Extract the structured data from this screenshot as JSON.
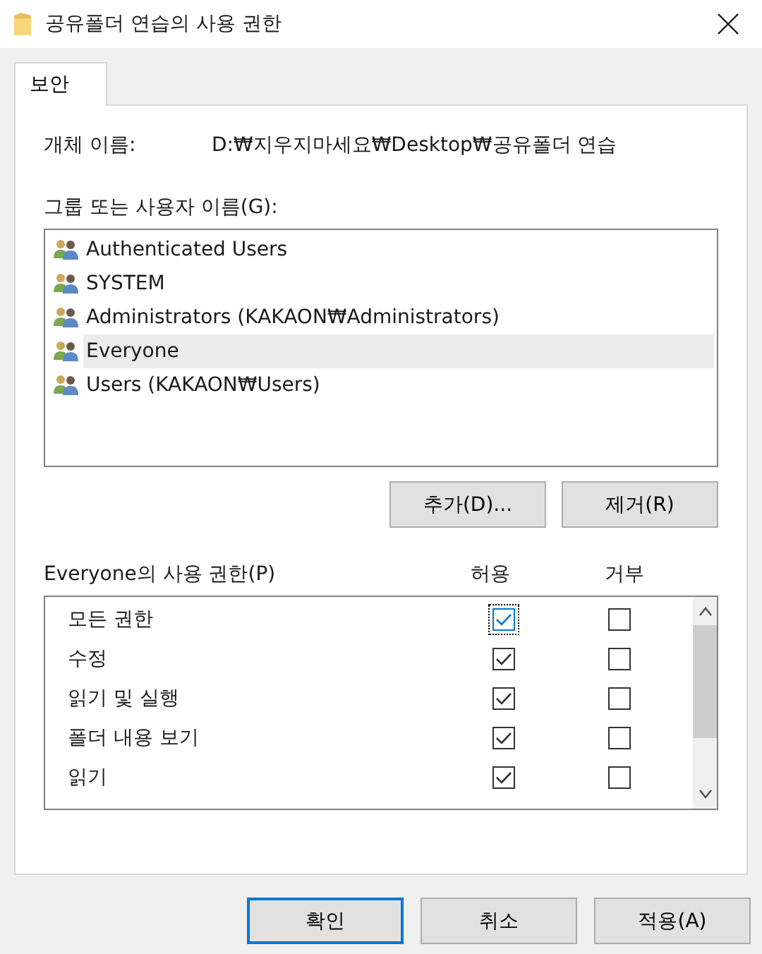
{
  "window": {
    "title": "공유폴더 연습의 사용 권한"
  },
  "tabs": [
    {
      "label": "보안",
      "selected": true
    }
  ],
  "object_name": {
    "label": "개체 이름:",
    "value": "D:₩지우지마세요₩Desktop₩공유폴더 연습"
  },
  "groups": {
    "label": "그룹 또는 사용자 이름(G):",
    "items": [
      {
        "name": "Authenticated Users",
        "selected": false
      },
      {
        "name": "SYSTEM",
        "selected": false
      },
      {
        "name": "Administrators (KAKAON₩Administrators)",
        "selected": false
      },
      {
        "name": "Everyone",
        "selected": true
      },
      {
        "name": "Users (KAKAON₩Users)",
        "selected": false
      }
    ],
    "buttons": [
      "추가(D)...",
      "제거(R)"
    ]
  },
  "permissions": {
    "label": "Everyone의 사용 권한(P)",
    "allow_header": "허용",
    "deny_header": "거부",
    "items": [
      {
        "name": "모든 권한",
        "allow": true,
        "deny": false,
        "focused": true
      },
      {
        "name": "수정",
        "allow": true,
        "deny": false,
        "focused": false
      },
      {
        "name": "읽기 및 실행",
        "allow": true,
        "deny": false,
        "focused": false
      },
      {
        "name": "폴더 내용 보기",
        "allow": true,
        "deny": false,
        "focused": false
      },
      {
        "name": "읽기",
        "allow": true,
        "deny": false,
        "focused": false
      }
    ]
  },
  "footer_buttons": [
    {
      "label": "확인",
      "default": true
    },
    {
      "label": "취소",
      "default": false
    },
    {
      "label": "적용(A)",
      "default": false
    }
  ]
}
